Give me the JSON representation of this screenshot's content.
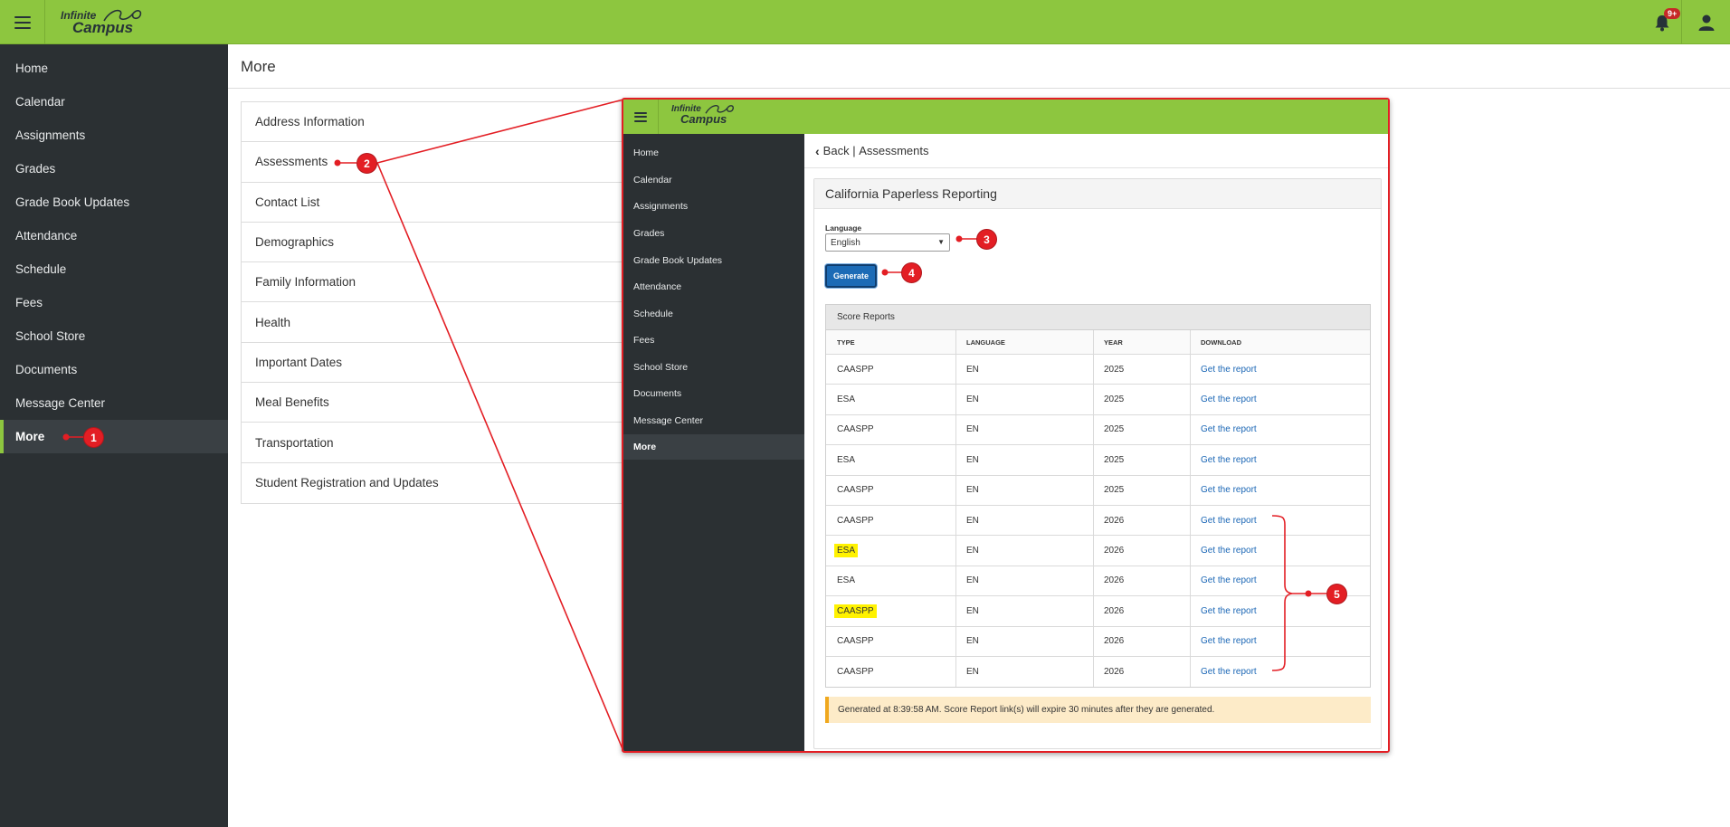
{
  "header": {
    "logo_line1": "Infinite",
    "logo_line2": "Campus",
    "notification_badge": "9+"
  },
  "sidebar": {
    "items": [
      "Home",
      "Calendar",
      "Assignments",
      "Grades",
      "Grade Book Updates",
      "Attendance",
      "Schedule",
      "Fees",
      "School Store",
      "Documents",
      "Message Center",
      "More"
    ],
    "active": "More"
  },
  "page": {
    "title": "More"
  },
  "more_list": [
    "Address Information",
    "Assessments",
    "Contact List",
    "Demographics",
    "Family Information",
    "Health",
    "Important Dates",
    "Meal Benefits",
    "Transportation",
    "Student Registration and Updates"
  ],
  "inset": {
    "back_label": "Back",
    "back_page": "Assessments",
    "card_title": "California Paperless Reporting",
    "language_label": "Language",
    "language_value": "English",
    "generate_label": "Generate",
    "reports_title": "Score Reports",
    "columns": [
      "TYPE",
      "LANGUAGE",
      "YEAR",
      "DOWNLOAD"
    ],
    "rows": [
      {
        "type": "CAASPP",
        "language": "EN",
        "year": "2025",
        "download": "Get the report",
        "highlight": false
      },
      {
        "type": "ESA",
        "language": "EN",
        "year": "2025",
        "download": "Get the report",
        "highlight": false
      },
      {
        "type": "CAASPP",
        "language": "EN",
        "year": "2025",
        "download": "Get the report",
        "highlight": false
      },
      {
        "type": "ESA",
        "language": "EN",
        "year": "2025",
        "download": "Get the report",
        "highlight": false
      },
      {
        "type": "CAASPP",
        "language": "EN",
        "year": "2025",
        "download": "Get the report",
        "highlight": false
      },
      {
        "type": "CAASPP",
        "language": "EN",
        "year": "2026",
        "download": "Get the report",
        "highlight": false
      },
      {
        "type": "ESA",
        "language": "EN",
        "year": "2026",
        "download": "Get the report",
        "highlight": true
      },
      {
        "type": "ESA",
        "language": "EN",
        "year": "2026",
        "download": "Get the report",
        "highlight": false
      },
      {
        "type": "CAASPP",
        "language": "EN",
        "year": "2026",
        "download": "Get the report",
        "highlight": true
      },
      {
        "type": "CAASPP",
        "language": "EN",
        "year": "2026",
        "download": "Get the report",
        "highlight": false
      },
      {
        "type": "CAASPP",
        "language": "EN",
        "year": "2026",
        "download": "Get the report",
        "highlight": false
      }
    ],
    "notice": "Generated at 8:39:58 AM. Score Report link(s) will expire 30 minutes after they are generated."
  },
  "annotations": {
    "markers": [
      "1",
      "2",
      "3",
      "4",
      "5"
    ],
    "color": "#e31e24"
  },
  "colors": {
    "topbar": "#8dc63f",
    "sidebar": "#2b3033",
    "link": "#1a66b5",
    "generate_button": "#1c6bb6",
    "highlight": "#fff200",
    "notice_bg": "#fdebc8"
  }
}
